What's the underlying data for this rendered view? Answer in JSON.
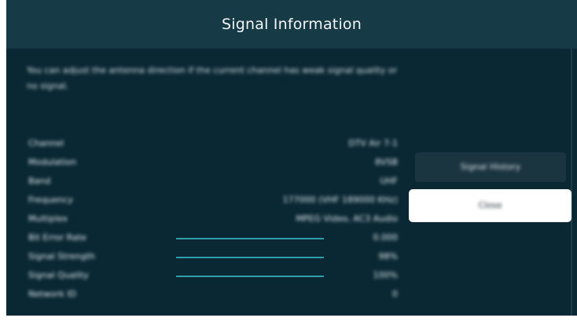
{
  "screen": {
    "title": "Signal Information",
    "description": "You can adjust the antenna direction if the current channel has weak signal quality or no signal.",
    "info_rows": [
      {
        "label": "Channel",
        "value": "DTV Air 7-1",
        "meter": null
      },
      {
        "label": "Modulation",
        "value": "8VSB",
        "meter": null
      },
      {
        "label": "Band",
        "value": "UHF",
        "meter": null
      },
      {
        "label": "Frequency",
        "value": "177000 (VHF 189000 KHz)",
        "meter": null
      },
      {
        "label": "Multiplex",
        "value": "MPEG Video, AC3 Audio",
        "meter": null
      },
      {
        "label": "Bit Error Rate",
        "value": "0.000",
        "meter": 0.55
      },
      {
        "label": "Signal Strength",
        "value": "98%",
        "meter": 0.55
      },
      {
        "label": "Signal Quality",
        "value": "100%",
        "meter": 0.55
      },
      {
        "label": "Network ID",
        "value": "0",
        "meter": null
      }
    ],
    "buttons": {
      "signal_history": "Signal History",
      "close": "Close"
    }
  },
  "colors": {
    "background": "#0b2a36",
    "header": "#163a46",
    "meter_fill": "#2fa7b4",
    "button_focused": "#ffffff",
    "button_normal": "#1b3540"
  }
}
